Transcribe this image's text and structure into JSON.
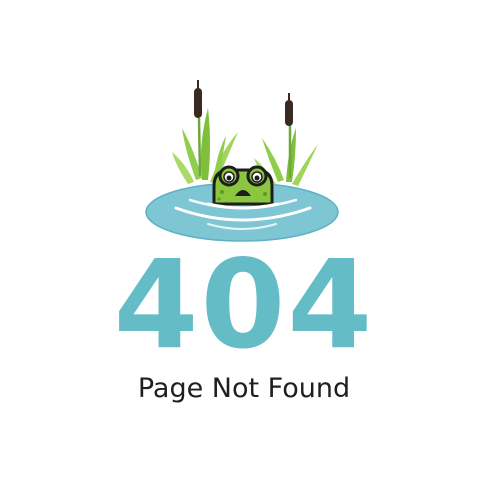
{
  "error_page": {
    "code": "404",
    "message": "Page Not Found"
  },
  "illustration": {
    "subject": "frog-in-pond",
    "icons": [
      "frog-icon",
      "pond-icon",
      "cattail-icon",
      "reed-grass-icon"
    ]
  },
  "colors": {
    "accent": "#64bcc7",
    "water": "#7ec6d3",
    "water_dark": "#5cb2c1",
    "frog_green": "#8cc63f",
    "frog_dark": "#1e1e1e",
    "reed_green": "#8fcd4c",
    "cattail_brown": "#3a2b22",
    "text": "#1f1f1f"
  }
}
